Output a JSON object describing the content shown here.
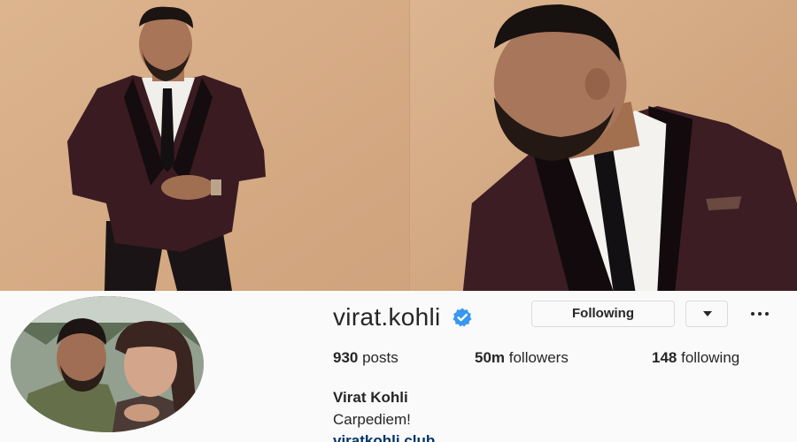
{
  "profile": {
    "username": "virat.kohli",
    "verified": true,
    "follow_button_label": "Following",
    "stats": {
      "posts_count": "930",
      "posts_label": "posts",
      "followers_count": "50m",
      "followers_label": "followers",
      "following_count": "148",
      "following_label": "following"
    },
    "full_name": "Virat Kohli",
    "bio": "Carpediem!",
    "link": "viratkohli.club"
  },
  "colors": {
    "background": "#fafafa",
    "photo_backdrop": "#d9b08a",
    "verified_badge": "#3897f0",
    "text": "#262626",
    "link": "#003569"
  },
  "icons": {
    "verified": "verified-badge-icon",
    "dropdown": "caret-down-icon",
    "more": "more-options-icon"
  }
}
